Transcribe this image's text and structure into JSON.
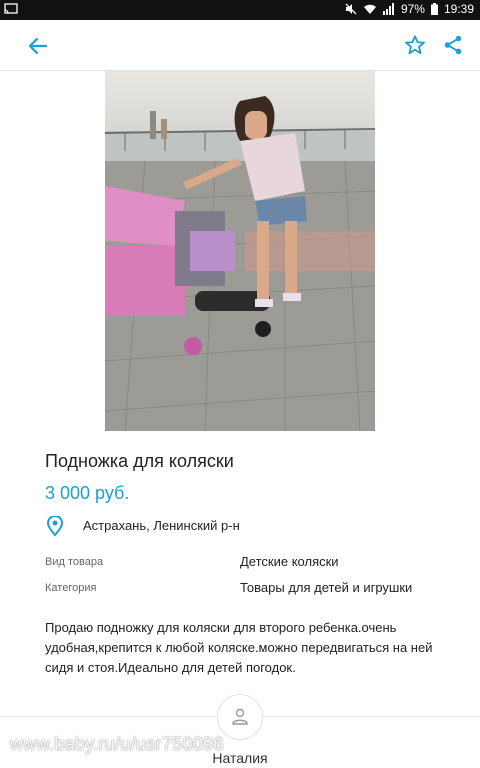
{
  "status_bar": {
    "battery": "97%",
    "time": "19:39"
  },
  "listing": {
    "title": "Подножка для коляски",
    "price": "3 000 руб.",
    "location": "Астрахань, Ленинский р-н",
    "properties": [
      {
        "label": "Вид товара",
        "value": "Детские коляски"
      },
      {
        "label": "Категория",
        "value": "Товары для детей и игрушки"
      }
    ],
    "description": "Продаю подножку для коляски для второго ребенка.очень удобная,крепится к любой коляске.можно передвигаться на ней сидя и стоя.Идеально для детей погодок."
  },
  "seller": {
    "name": "Наталия"
  },
  "watermark": {
    "text": "www.baby.ru/u/usr750096"
  },
  "colors": {
    "accent": "#1a9fd8",
    "statusbar": "#111111"
  },
  "icons": [
    "cast-icon",
    "mute-icon",
    "wifi-icon",
    "signal-icon",
    "battery-icon",
    "back-arrow-icon",
    "star-icon",
    "share-icon",
    "location-pin-icon",
    "user-icon"
  ]
}
